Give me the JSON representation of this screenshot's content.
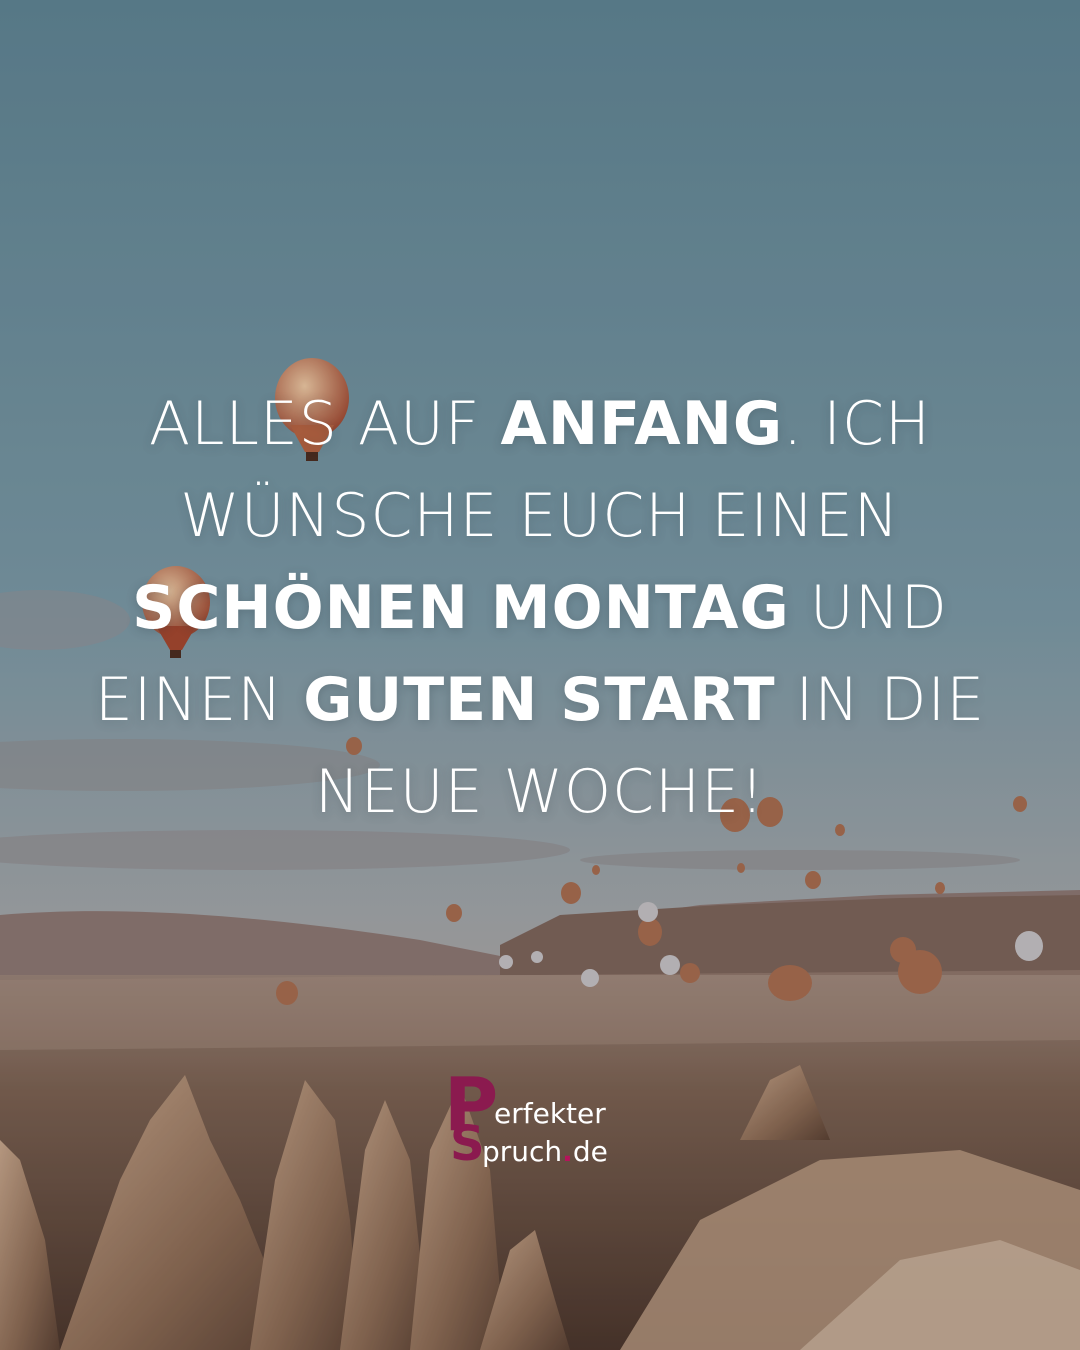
{
  "quote": {
    "line1": {
      "a": "ALLES AUF ",
      "b": "ANFANG",
      "c": ". ICH"
    },
    "line2": {
      "a": "WÜNSCHE EUCH EINEN"
    },
    "line3": {
      "b": "SCHÖNEN MONTAG",
      "c": " UND"
    },
    "line4": {
      "a": "EINEN ",
      "b": "GUTEN START",
      "c": " IN DIE"
    },
    "line5": {
      "a": "NEUE WOCHE!"
    }
  },
  "logo": {
    "letter_p": "P",
    "letter_s": "S",
    "text_top": "erfekter",
    "text_bottom": "pruch",
    "dot": ".",
    "tld": "de"
  },
  "colors": {
    "sky_top": "#5f8493",
    "sky_bottom": "#b4a6a2",
    "text": "#ffffff",
    "logo_accent": "#8b1a4f"
  }
}
